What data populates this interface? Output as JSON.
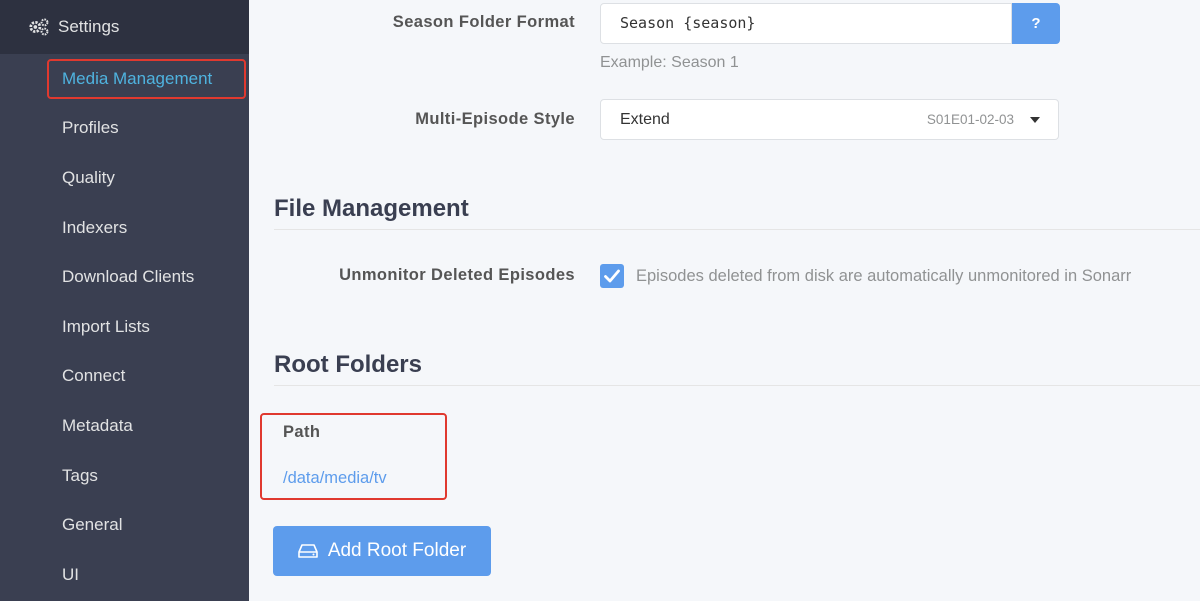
{
  "sidebar": {
    "header": "Settings",
    "items": [
      {
        "label": "Media Management",
        "active": true
      },
      {
        "label": "Profiles"
      },
      {
        "label": "Quality"
      },
      {
        "label": "Indexers"
      },
      {
        "label": "Download Clients"
      },
      {
        "label": "Import Lists"
      },
      {
        "label": "Connect"
      },
      {
        "label": "Metadata"
      },
      {
        "label": "Tags"
      },
      {
        "label": "General"
      },
      {
        "label": "UI"
      }
    ]
  },
  "naming": {
    "season_folder_label": "Season Folder Format",
    "season_folder_value": "Season {season}",
    "help_label": "?",
    "season_folder_example": "Example: Season 1",
    "multi_episode_label": "Multi-Episode Style",
    "multi_episode_value": "Extend",
    "multi_episode_hint": "S01E01-02-03"
  },
  "file_management": {
    "title": "File Management",
    "unmonitor_label": "Unmonitor Deleted Episodes",
    "unmonitor_checked": true,
    "unmonitor_help": "Episodes deleted from disk are automatically unmonitored in Sonarr"
  },
  "root_folders": {
    "title": "Root Folders",
    "path_header": "Path",
    "paths": [
      "/data/media/tv"
    ],
    "add_button": "Add Root Folder"
  },
  "colors": {
    "sidebar_bg": "#3a3f51",
    "sidebar_header_bg": "#2d3140",
    "accent": "#5d9cec",
    "highlight_border": "#e0392f"
  }
}
